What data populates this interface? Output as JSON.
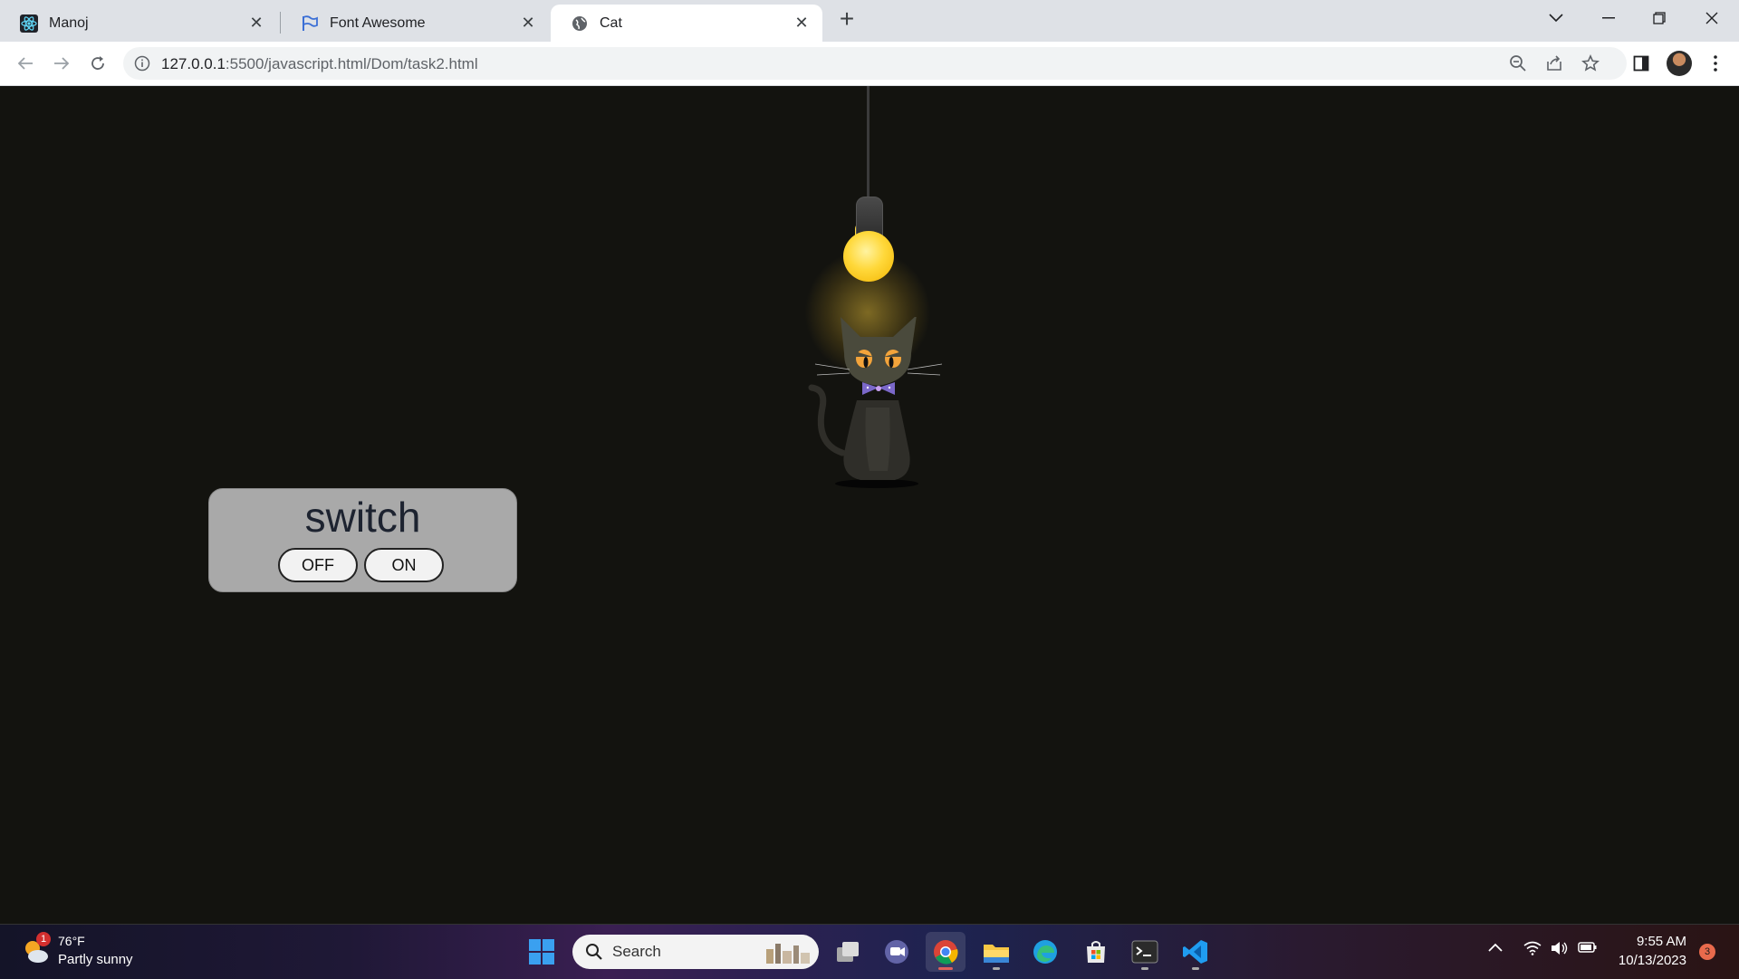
{
  "browser": {
    "tabs": [
      {
        "title": "Manoj",
        "icon": "react-icon",
        "active": false
      },
      {
        "title": "Font Awesome",
        "icon": "flag-icon",
        "active": false
      },
      {
        "title": "Cat",
        "icon": "globe-icon",
        "active": true
      }
    ],
    "url_host": "127.0.0.1",
    "url_rest": ":5500/javascript.html/Dom/task2.html"
  },
  "page": {
    "switch_title": "switch",
    "off_label": "OFF",
    "on_label": "ON",
    "bulb_state": "on"
  },
  "taskbar": {
    "weather_temp": "76°F",
    "weather_desc": "Partly sunny",
    "weather_badge": "1",
    "search_label": "Search",
    "time": "9:55 AM",
    "date": "10/13/2023",
    "notification_count": "3"
  },
  "colors": {
    "page_bg": "#13130f",
    "panel_bg": "#a9a9a9",
    "bulb": "#ffd83a"
  }
}
